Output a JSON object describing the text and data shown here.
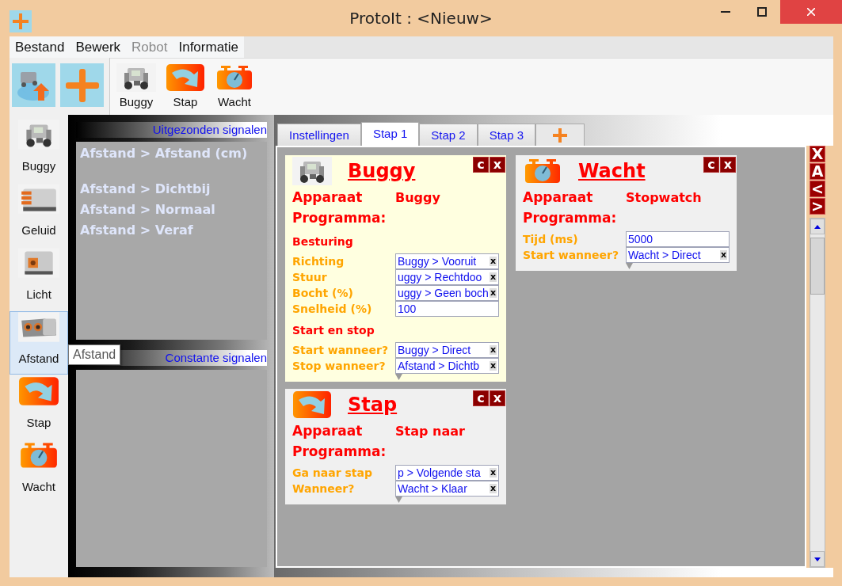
{
  "window": {
    "title": "ProtoIt : <Nieuw>"
  },
  "menu": [
    {
      "label": "Bestand",
      "disabled": false
    },
    {
      "label": "Bewerk",
      "disabled": false
    },
    {
      "label": "Robot",
      "disabled": true
    },
    {
      "label": "Informatie",
      "disabled": false
    }
  ],
  "toolbar": {
    "blocks": [
      {
        "kind": "buggy",
        "label": "Buggy"
      },
      {
        "kind": "step",
        "label": "Stap"
      },
      {
        "kind": "wait",
        "label": "Wacht"
      }
    ]
  },
  "sidebar": {
    "items": [
      {
        "kind": "buggy",
        "label": "Buggy",
        "selected": false
      },
      {
        "kind": "sound",
        "label": "Geluid",
        "selected": false
      },
      {
        "kind": "light",
        "label": "Licht",
        "selected": false
      },
      {
        "kind": "distance",
        "label": "Afstand",
        "selected": true
      },
      {
        "kind": "step",
        "label": "Stap",
        "selected": false
      },
      {
        "kind": "wait",
        "label": "Wacht",
        "selected": false
      }
    ],
    "tooltip": "Afstand"
  },
  "signal_panels": [
    {
      "title": "Uitgezonden signalen",
      "groups": [
        [
          "Afstand > Afstand (cm)"
        ],
        [
          "Afstand > Dichtbij",
          "Afstand > Normaal",
          "Afstand > Veraf"
        ]
      ]
    },
    {
      "title": "Constante signalen"
    }
  ],
  "tabs": [
    {
      "label": "Instellingen",
      "selected": false
    },
    {
      "label": "Stap 1",
      "selected": true
    },
    {
      "label": "Stap 2",
      "selected": false
    },
    {
      "label": "Stap 3",
      "selected": false
    }
  ],
  "side_buttons": [
    "X",
    "A",
    "<",
    ">"
  ],
  "columns": [
    {
      "cards": [
        {
          "kind": "buggy",
          "title": "Buggy",
          "selected": true,
          "buttons": [
            "c",
            "x"
          ],
          "device_label": "Apparaat",
          "device": "Buggy",
          "program_label": "Programma:",
          "rows": [
            {
              "kind": "heading",
              "text": "Besturing"
            },
            {
              "kind": "field",
              "label": "Richting",
              "value": "Buggy > Vooruit",
              "clear": "x"
            },
            {
              "kind": "field",
              "label": "Stuur",
              "value": "uggy > Rechtdoo",
              "clear": "x"
            },
            {
              "kind": "field",
              "label": "Bocht (%)",
              "value": "uggy > Geen boch",
              "clear": "x"
            },
            {
              "kind": "field",
              "label": "Snelheid (%)",
              "value": "100"
            },
            {
              "kind": "heading",
              "text": "Start en stop"
            },
            {
              "kind": "field",
              "label": "Start wanneer?",
              "value": "Buggy > Direct",
              "clear": "x"
            },
            {
              "kind": "field",
              "label": "Stop wanneer?",
              "value": "Afstand > Dichtb",
              "clear": "x"
            }
          ]
        },
        {
          "kind": "step",
          "title": "Stap",
          "selected": false,
          "buttons": [
            "c",
            "x"
          ],
          "device_label": "Apparaat",
          "device": "Stap naar",
          "program_label": "Programma:",
          "rows": [
            {
              "kind": "field",
              "label": "Ga naar stap",
              "value": "p > Volgende sta",
              "clear": "x"
            },
            {
              "kind": "field",
              "label": "Wanneer?",
              "value": "Wacht > Klaar",
              "clear": "x"
            }
          ]
        }
      ]
    },
    {
      "cards": [
        {
          "kind": "wait",
          "title": "Wacht",
          "selected": false,
          "buttons": [
            "c",
            "x"
          ],
          "device_label": "Apparaat",
          "device": "Stopwatch",
          "program_label": "Programma:",
          "rows": [
            {
              "kind": "field",
              "label": "Tijd (ms)",
              "value": "5000"
            },
            {
              "kind": "field",
              "label": "Start wanneer?",
              "value": "Wacht > Direct",
              "clear": "x"
            }
          ]
        }
      ]
    }
  ]
}
